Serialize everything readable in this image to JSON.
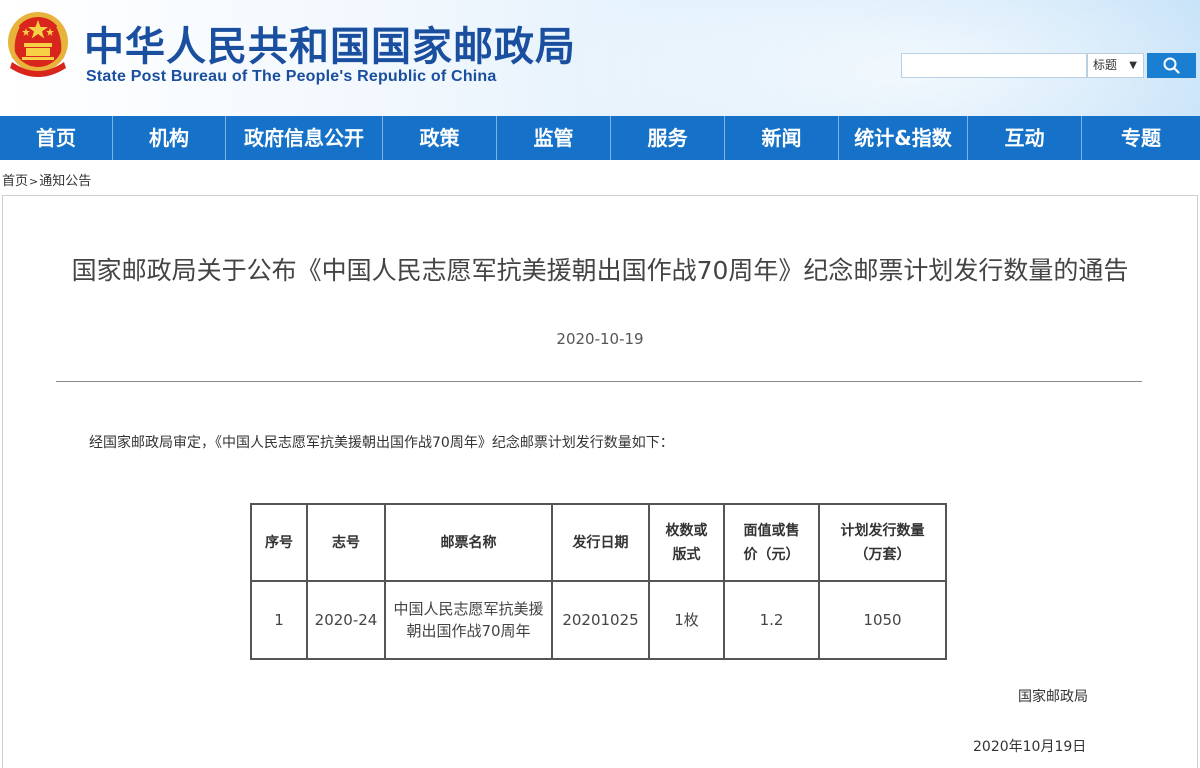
{
  "header": {
    "title_cn": "中华人民共和国国家邮政局",
    "title_en": "State Post Bureau of The People's Republic of China",
    "search": {
      "placeholder": "",
      "select_value": "标题"
    }
  },
  "nav": {
    "items": [
      "首页",
      "机构",
      "政府信息公开",
      "政策",
      "监管",
      "服务",
      "新闻",
      "统计&指数",
      "互动",
      "专题"
    ]
  },
  "breadcrumb": {
    "home": "首页",
    "sep": ">",
    "current": "通知公告"
  },
  "article": {
    "title": "国家邮政局关于公布《中国人民志愿军抗美援朝出国作战70周年》纪念邮票计划发行数量的通告",
    "date": "2020-10-19",
    "intro": "经国家邮政局审定，《中国人民志愿军抗美援朝出国作战70周年》纪念邮票计划发行数量如下：",
    "table": {
      "headers": [
        "序号",
        "志号",
        "邮票名称",
        "发行日期",
        "枚数或版式",
        "面值或售价（元）",
        "计划发行数量（万套）"
      ],
      "rows": [
        [
          "1",
          "2020-24",
          "中国人民志愿军抗美援朝出国作战70周年",
          "20201025",
          "1枚",
          "1.2",
          "1050"
        ]
      ]
    },
    "signature_org": "国家邮政局",
    "signature_date": "2020年10月19日"
  },
  "colors": {
    "brand_blue": "#1572c8",
    "title_blue": "#1a4fa0",
    "search_blue": "#1b7fd1"
  }
}
